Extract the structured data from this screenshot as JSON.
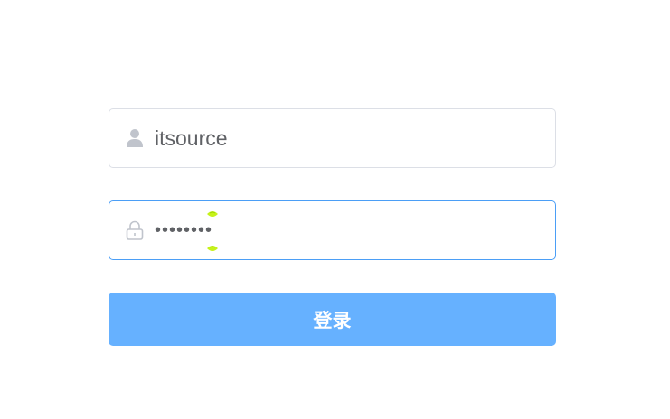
{
  "login_form": {
    "username": {
      "icon": "user-icon",
      "value": "itsource"
    },
    "password": {
      "icon": "lock-icon",
      "value": "itsource"
    },
    "submit_label": "登录"
  },
  "colors": {
    "focus_border": "#4b9ef6",
    "button_bg": "#66b1ff",
    "icon": "#c0c4cc",
    "text": "#606266",
    "caret_marker": "#c6f21a"
  }
}
